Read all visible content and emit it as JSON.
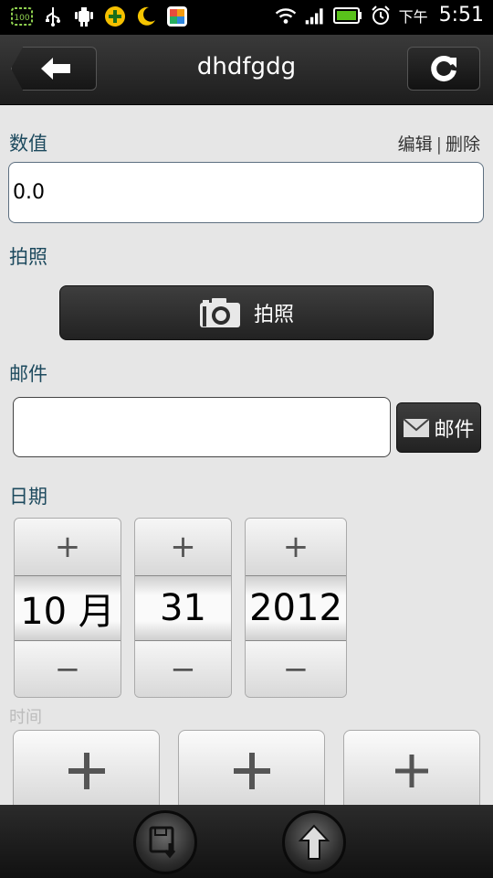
{
  "status_bar": {
    "icons": [
      "battery-100-icon",
      "usb-icon",
      "android-debug-icon",
      "add-circle-icon",
      "moon-icon",
      "app-icon"
    ],
    "right_icons": [
      "wifi-icon",
      "signal-icon",
      "battery-icon",
      "alarm-icon"
    ],
    "ampm": "下午",
    "time": "5:51"
  },
  "header": {
    "title": "dhdfgdg",
    "back_icon": "back-arrow-icon",
    "refresh_icon": "refresh-icon"
  },
  "numeric": {
    "label": "数值",
    "edit": "编辑",
    "separator": "|",
    "delete": "删除",
    "value": "0.0"
  },
  "photo": {
    "label": "拍照",
    "button_label": "拍照"
  },
  "mail": {
    "label": "邮件",
    "value": "",
    "button_label": "邮件"
  },
  "date": {
    "label": "日期",
    "plus": "+",
    "minus": "−",
    "month": "10 月",
    "day": "31",
    "year": "2012"
  },
  "time": {
    "label": "时间"
  },
  "colors": {
    "label_text": "#1d4a5e",
    "bar_dark": "#1d1d1d",
    "background": "#e6e6e6"
  }
}
